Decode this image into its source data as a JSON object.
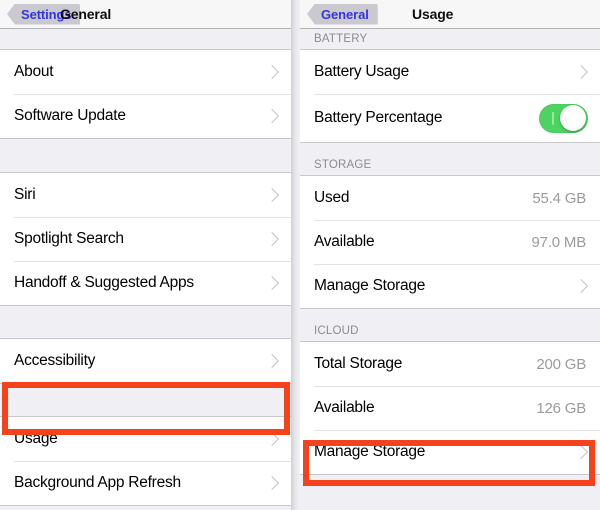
{
  "left_screen": {
    "nav": {
      "back_label": "Settings",
      "title": "General"
    },
    "groups": [
      {
        "rows": [
          {
            "label": "About",
            "accessory": "chevron"
          },
          {
            "label": "Software Update",
            "accessory": "chevron"
          }
        ]
      },
      {
        "rows": [
          {
            "label": "Siri",
            "accessory": "chevron"
          },
          {
            "label": "Spotlight Search",
            "accessory": "chevron"
          },
          {
            "label": "Handoff & Suggested Apps",
            "accessory": "chevron"
          }
        ]
      },
      {
        "rows": [
          {
            "label": "Accessibility",
            "accessory": "chevron"
          }
        ]
      },
      {
        "rows": [
          {
            "label": "Usage",
            "accessory": "chevron",
            "highlighted": true
          },
          {
            "label": "Background App Refresh",
            "accessory": "chevron"
          }
        ]
      }
    ]
  },
  "right_screen": {
    "nav": {
      "back_label": "General",
      "title": "Usage"
    },
    "sections": [
      {
        "header": "BATTERY",
        "rows": [
          {
            "label": "Battery Usage",
            "accessory": "chevron"
          },
          {
            "label": "Battery Percentage",
            "accessory": "toggle",
            "toggle_on": true
          }
        ]
      },
      {
        "header": "STORAGE",
        "rows": [
          {
            "label": "Used",
            "value": "55.4 GB"
          },
          {
            "label": "Available",
            "value": "97.0 MB"
          },
          {
            "label": "Manage Storage",
            "accessory": "chevron"
          }
        ]
      },
      {
        "header": "ICLOUD",
        "rows": [
          {
            "label": "Total Storage",
            "value": "200 GB"
          },
          {
            "label": "Available",
            "value": "126 GB"
          },
          {
            "label": "Manage Storage",
            "accessory": "chevron",
            "highlighted": true
          }
        ]
      }
    ]
  },
  "annotations": {
    "color": "#f5421c",
    "boxes": [
      {
        "target": "Usage",
        "screen": "left"
      },
      {
        "target": "Manage Storage",
        "screen": "right"
      }
    ]
  }
}
